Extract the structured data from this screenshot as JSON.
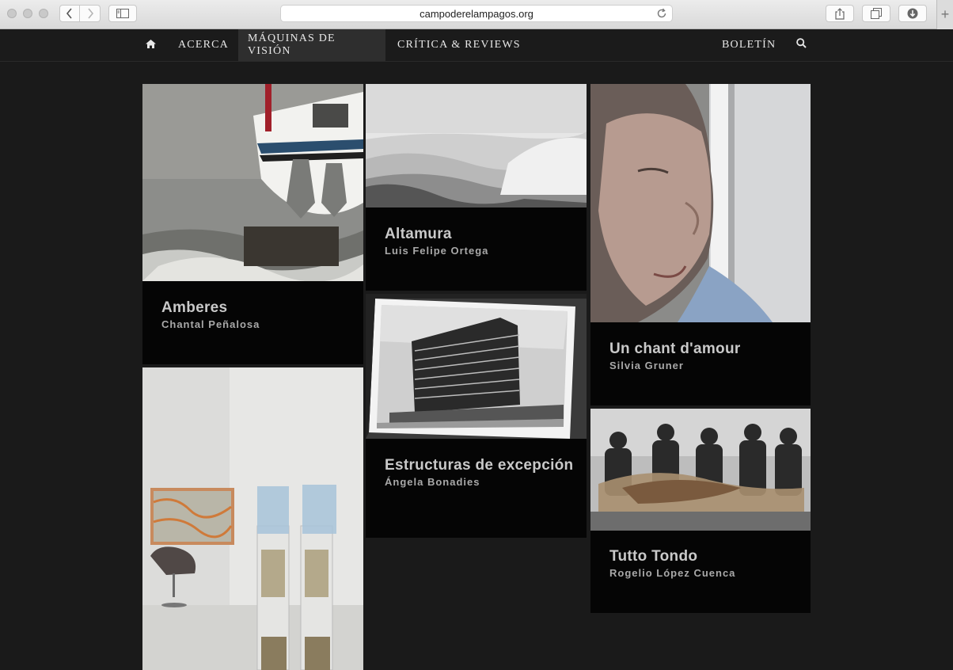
{
  "browser": {
    "url": "campoderelampagos.org",
    "icons": {
      "back": "chevron-left-icon",
      "forward": "chevron-right-icon",
      "sidebar": "sidebar-icon",
      "reload": "reload-icon",
      "share": "share-icon",
      "tabs": "tabs-icon",
      "downloads": "download-icon",
      "new_tab": "+"
    }
  },
  "nav": {
    "home_icon": "home-icon",
    "items": [
      {
        "label": "Acerca"
      },
      {
        "label": "Máquinas de visión"
      },
      {
        "label": "Crítica & Reviews"
      }
    ],
    "right_label": "Boletín",
    "search_icon": "search-icon",
    "active_index": 1
  },
  "cards": [
    {
      "title": "Amberes",
      "author": "Chantal Peñalosa",
      "image": "ship-anchor-photo"
    },
    {
      "title": "Altamura",
      "author": "Luis Felipe Ortega",
      "image": "dunes-photo"
    },
    {
      "title": "Un chant d'amour",
      "author": "Silvia Gruner",
      "image": "face-against-wall-photo"
    },
    {
      "title": "Estructuras de excepción",
      "author": "Ángela Bonadies",
      "image": "building-photograph"
    },
    {
      "title": "Tutto Tondo",
      "author": "Rogelio López Cuenca",
      "image": "collage-photo"
    },
    {
      "title": "",
      "author": "",
      "image": "gallery-water-dispensers-photo"
    }
  ],
  "colors": {
    "page_bg": "#1a1a1a",
    "card_bg": "#050505",
    "title": "#c9c9c9",
    "author": "#a9a9a9",
    "nav_text": "#e8e8e8",
    "nav_active_bg": "#2e2e2e"
  }
}
